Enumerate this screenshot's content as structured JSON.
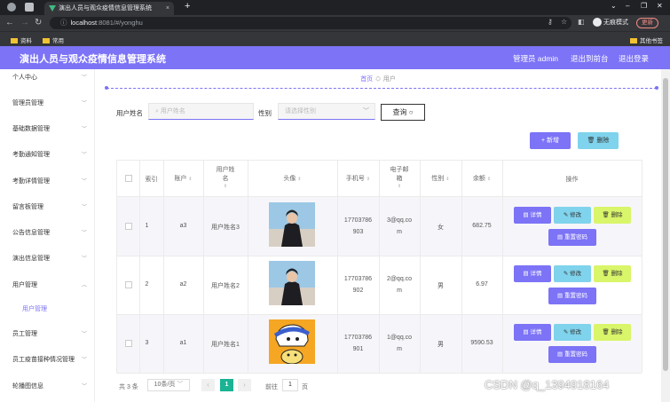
{
  "browser": {
    "tab_title": "演出人员与观众疫情信息管理系统",
    "url_host": "localhost",
    "url_path": ":8081/#/yonghu",
    "incognito_label": "无痕模式",
    "update_label": "更新",
    "bookmarks": [
      "资料",
      "常用"
    ],
    "bookmarks_right": "其他书签"
  },
  "header": {
    "title": "演出人员与观众疫情信息管理系统",
    "admin_label": "管理员 admin",
    "back_label": "退出到前台",
    "logout_label": "退出登录"
  },
  "sidebar": {
    "items": [
      {
        "label": "个人中心"
      },
      {
        "label": "管理员管理"
      },
      {
        "label": "基础数据管理"
      },
      {
        "label": "考勤通知管理"
      },
      {
        "label": "考勤详情管理"
      },
      {
        "label": "留言板管理"
      },
      {
        "label": "公告信息管理"
      },
      {
        "label": "演出信息管理"
      },
      {
        "label": "用户管理"
      },
      {
        "label": "用户管理"
      },
      {
        "label": "员工管理"
      },
      {
        "label": "员工疫苗接种情况管理"
      },
      {
        "label": "轮播图信息"
      }
    ]
  },
  "breadcrumb": {
    "home": "首页",
    "current": "用户"
  },
  "search": {
    "name_label": "用户姓名",
    "name_placeholder": "用户姓名",
    "gender_label": "性别",
    "gender_placeholder": "请选择性别",
    "query_label": "查询"
  },
  "actions": {
    "add_label": "+ 新增",
    "delete_label": "删除"
  },
  "table": {
    "headers": [
      "索引",
      "账户",
      "用户姓名",
      "头像",
      "手机号",
      "电子邮箱",
      "性别",
      "余额",
      "操作"
    ],
    "rows": [
      {
        "index": "1",
        "account": "a3",
        "name": "用户姓名3",
        "phone_a": "17703786",
        "phone_b": "903",
        "email_a": "3@qq.co",
        "email_b": "m",
        "gender": "女",
        "balance": "682.75"
      },
      {
        "index": "2",
        "account": "a2",
        "name": "用户姓名2",
        "phone_a": "17703786",
        "phone_b": "902",
        "email_a": "2@qq.co",
        "email_b": "m",
        "gender": "男",
        "balance": "6.97"
      },
      {
        "index": "3",
        "account": "a1",
        "name": "用户姓名1",
        "phone_a": "17703786",
        "phone_b": "901",
        "email_a": "1@qq.co",
        "email_b": "m",
        "gender": "男",
        "balance": "9590.53"
      }
    ],
    "op_labels": {
      "detail": "详情",
      "edit": "修改",
      "delete": "删除",
      "reset_pwd": "重置密码"
    }
  },
  "pagination": {
    "total": "共 3 条",
    "page_size": "10条/页",
    "current_page": "1",
    "goto_label": "前往",
    "goto_value": "1",
    "page_suffix": "页"
  },
  "watermark": "CSDN @q_1394918164",
  "colors": {
    "accent": "#7c73f6",
    "cyan": "#7fd3ec",
    "lime": "#d9f56a",
    "pager": "#1ab394"
  }
}
